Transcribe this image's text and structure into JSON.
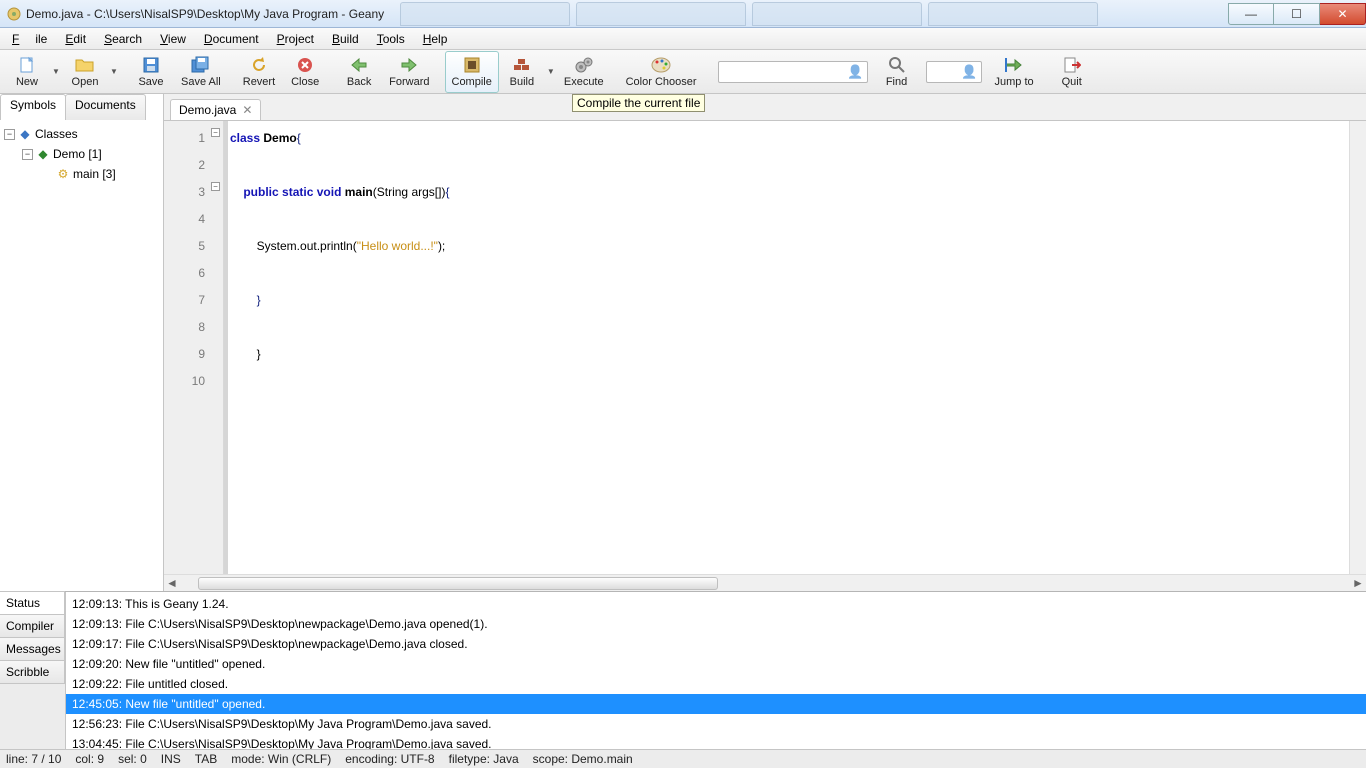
{
  "window": {
    "title": "Demo.java - C:\\Users\\NisalSP9\\Desktop\\My Java Program - Geany"
  },
  "menu": {
    "file": "File",
    "edit": "Edit",
    "search": "Search",
    "view": "View",
    "document": "Document",
    "project": "Project",
    "build": "Build",
    "tools": "Tools",
    "help": "Help"
  },
  "toolbar": {
    "new": "New",
    "open": "Open",
    "save": "Save",
    "save_all": "Save All",
    "revert": "Revert",
    "close": "Close",
    "back": "Back",
    "forward": "Forward",
    "compile": "Compile",
    "build": "Build",
    "execute": "Execute",
    "color_chooser": "Color Chooser",
    "find": "Find",
    "jump_to": "Jump to",
    "quit": "Quit"
  },
  "tooltip": "Compile the current file",
  "sidebar": {
    "tabs": {
      "symbols": "Symbols",
      "documents": "Documents"
    },
    "tree": {
      "classes": "Classes",
      "demo": "Demo [1]",
      "main": "main [3]"
    }
  },
  "editor_tab": {
    "name": "Demo.java"
  },
  "code": {
    "l1a": "class",
    "l1b": "Demo",
    "l1c": "{",
    "l3a": "public",
    "l3b": "static",
    "l3c": "void",
    "l3d": "main",
    "l3e": "(String args[])",
    "l3f": "{",
    "l5a": "System.out.println(",
    "l5b": "\"Hello world...!\"",
    "l5c": ");",
    "l7": "}",
    "l9": "}"
  },
  "gutter": [
    "1",
    "2",
    "3",
    "4",
    "5",
    "6",
    "7",
    "8",
    "9",
    "10"
  ],
  "msg_tabs": {
    "status": "Status",
    "compiler": "Compiler",
    "messages": "Messages",
    "scribble": "Scribble"
  },
  "messages": [
    "12:09:13: This is Geany 1.24.",
    "12:09:13: File C:\\Users\\NisalSP9\\Desktop\\newpackage\\Demo.java opened(1).",
    "12:09:17: File C:\\Users\\NisalSP9\\Desktop\\newpackage\\Demo.java closed.",
    "12:09:20: New file \"untitled\" opened.",
    "12:09:22: File untitled closed.",
    "12:45:05: New file \"untitled\" opened.",
    "12:56:23: File C:\\Users\\NisalSP9\\Desktop\\My Java Program\\Demo.java saved.",
    "13:04:45: File C:\\Users\\NisalSP9\\Desktop\\My Java Program\\Demo.java saved."
  ],
  "messages_selected_index": 5,
  "status": {
    "line": "line: 7 / 10",
    "col": "col: 9",
    "sel": "sel: 0",
    "ins": "INS",
    "tab": "TAB",
    "mode": "mode: Win (CRLF)",
    "enc": "encoding: UTF-8",
    "ftype": "filetype: Java",
    "scope": "scope: Demo.main"
  }
}
